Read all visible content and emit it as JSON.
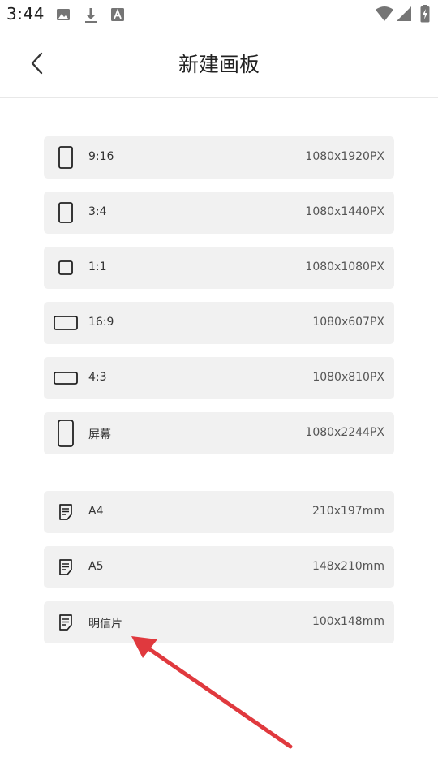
{
  "status_bar": {
    "time": "3:44",
    "icons": [
      "image-icon",
      "download-icon",
      "font-a-icon",
      "wifi-icon",
      "signal-icon",
      "battery-charging-icon"
    ]
  },
  "header": {
    "title": "新建画板",
    "back_icon": "back-arrow-icon"
  },
  "ratio_options": [
    {
      "label": "9:16",
      "size": "1080x1920PX",
      "icon": "portrait-rect-icon"
    },
    {
      "label": "3:4",
      "size": "1080x1440PX",
      "icon": "portrait-rect-icon"
    },
    {
      "label": "1:1",
      "size": "1080x1080PX",
      "icon": "square-icon"
    },
    {
      "label": "16:9",
      "size": "1080x607PX",
      "icon": "landscape-rect-icon"
    },
    {
      "label": "4:3",
      "size": "1080x810PX",
      "icon": "landscape-rect-icon"
    },
    {
      "label": "屏幕",
      "size": "1080x2244PX",
      "icon": "phone-screen-icon"
    }
  ],
  "paper_options": [
    {
      "label": "A4",
      "size": "210x197mm",
      "icon": "document-icon"
    },
    {
      "label": "A5",
      "size": "148x210mm",
      "icon": "document-icon"
    },
    {
      "label": "明信片",
      "size": "100x148mm",
      "icon": "document-icon"
    }
  ],
  "annotation": {
    "type": "red-arrow",
    "color": "#e0393e",
    "points_to": "明信片"
  }
}
